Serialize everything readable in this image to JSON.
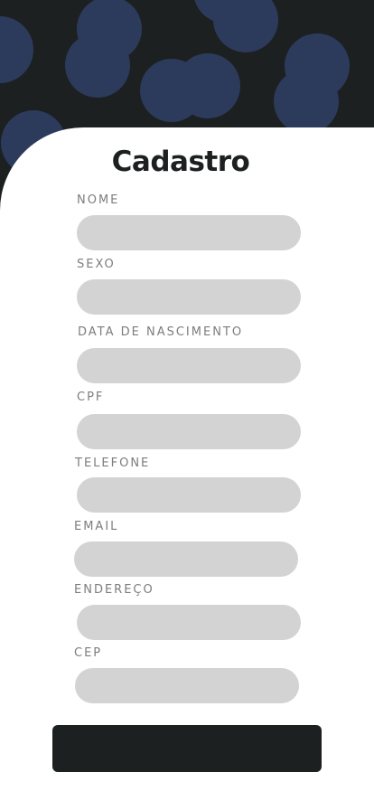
{
  "theme": {
    "background": "#1d2021",
    "circle_color": "#2c3b5c",
    "card": "#ffffff",
    "input_fill": "#d3d3d3",
    "label_color": "#7d7d7d"
  },
  "form": {
    "title": "Cadastro",
    "fields": {
      "nome": {
        "label": "NOME",
        "value": ""
      },
      "sexo": {
        "label": "SEXO",
        "value": ""
      },
      "data_nascimento": {
        "label": "DATA DE NASCIMENTO",
        "value": ""
      },
      "cpf": {
        "label": "CPF",
        "value": ""
      },
      "telefone": {
        "label": "TELEFONE",
        "value": ""
      },
      "email": {
        "label": "EMAIL",
        "value": ""
      },
      "endereco": {
        "label": "ENDEREÇO",
        "value": ""
      },
      "cep": {
        "label": "CEP",
        "value": ""
      }
    },
    "submit_label": ""
  }
}
